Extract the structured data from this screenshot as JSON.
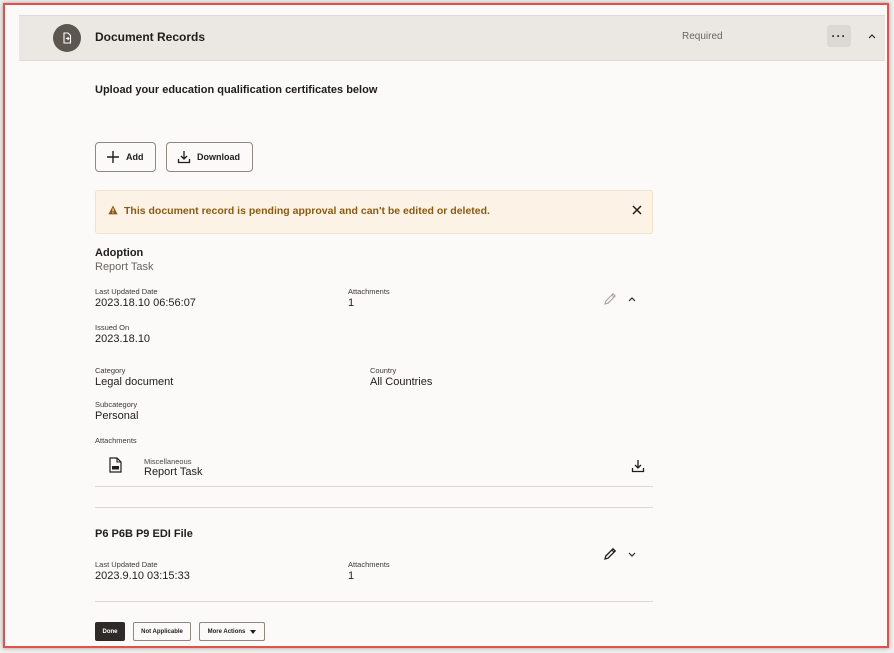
{
  "header": {
    "title": "Document Records",
    "status": "Required",
    "more_label": "···"
  },
  "intro": "Upload your education qualification certificates below",
  "toolbar": {
    "add_label": "Add",
    "download_label": "Download"
  },
  "alert": {
    "message": "This document record is pending approval and can't be edited or deleted."
  },
  "records": [
    {
      "title": "Adoption",
      "subtitle": "Report Task",
      "last_updated_label": "Last Updated Date",
      "last_updated": "2023.18.10 06:56:07",
      "attachments_label": "Attachments",
      "attachments": "1",
      "issued_on_label": "Issued On",
      "issued_on": "2023.18.10",
      "category_label": "Category",
      "category": "Legal document",
      "country_label": "Country",
      "country": "All Countries",
      "subcategory_label": "Subcategory",
      "subcategory": "Personal",
      "attachment_section_label": "Attachments",
      "attachment_item": {
        "category": "Miscellaneous",
        "name": "Report Task",
        "icon": "pdf-file-icon"
      }
    },
    {
      "title": "P6 P6B P9 EDI File",
      "last_updated_label": "Last Updated Date",
      "last_updated": "2023.9.10 03:15:33",
      "attachments_label": "Attachments",
      "attachments": "1"
    }
  ],
  "footer": {
    "done_label": "Done",
    "not_applicable_label": "Not Applicable",
    "more_actions_label": "More Actions"
  },
  "colors": {
    "accent": "#2e2a27",
    "alert_bg": "#fcf3e6",
    "alert_text": "#8b5a10",
    "frame_border": "#e0524f"
  }
}
